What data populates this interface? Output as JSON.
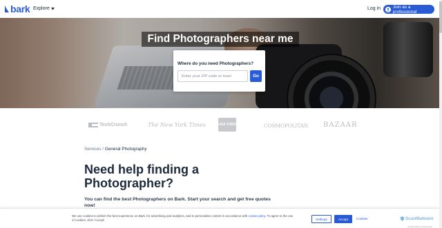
{
  "header": {
    "logo_text": "bark",
    "explore_label": "Explore",
    "login_label": "Log in",
    "join_label": "Join as a professional"
  },
  "hero": {
    "title": "Find Photographers near me",
    "question": "Where do you need Photographers?",
    "zip_placeholder": "Enter your ZIP code or town",
    "go_label": "Go"
  },
  "press": {
    "techcrunch": "TechCrunch",
    "nyt": "The New York Times",
    "usa_today": "USA TODAY",
    "cosmopolitan": "COSMOPOLITAN",
    "bazaar": "BAZAAR"
  },
  "breadcrumb": {
    "parent": "Services",
    "separator": " / ",
    "current": "General Photography"
  },
  "main": {
    "title": "Need help finding a Photographer?",
    "intro": "You can find the best Photographers on Bark. Start your search and get free quotes now!"
  },
  "cookie": {
    "text_before": "We use cookies to deliver the best experience on Bark, for advertising and analytics, and to personalise content in accordance with ",
    "policy_link": "cookie policy",
    "text_after": ". To agree to the use of cookies, click 'Accept'.",
    "settings_label": "Settings",
    "accept_label": "Accept",
    "cookies_link": "Cookies",
    "scan_brand": "ScanMalware",
    "scan_sub": "Cookie banner powered by"
  },
  "colors": {
    "brand_blue": "#2a5bd7",
    "text_dark": "#1e2a3b",
    "press_grey": "#b9bcc0"
  },
  "icons": {
    "logo": "bark-logo-icon",
    "explore_caret": "chevron-down-icon",
    "join": "user-plus-icon",
    "scan": "shield-icon"
  }
}
